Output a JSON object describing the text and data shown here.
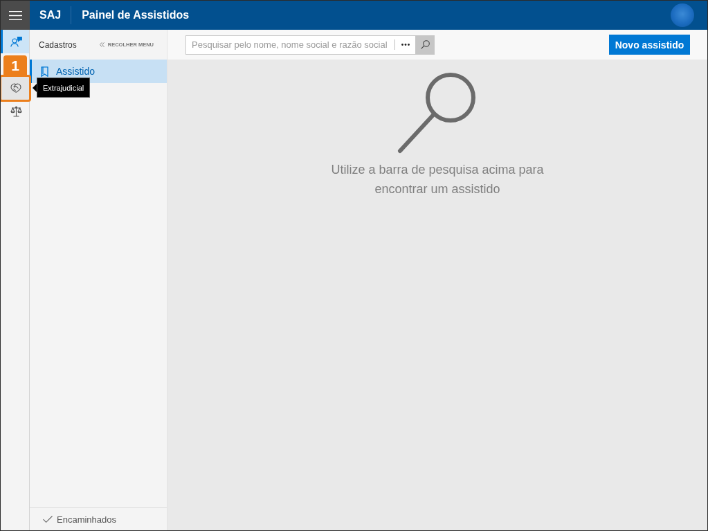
{
  "header": {
    "app_name": "SAJ",
    "title": "Painel de Assistidos"
  },
  "rail": {
    "items": [
      {
        "kind": "person",
        "selected": true,
        "hovered": false
      },
      {
        "kind": "handshake",
        "selected": false,
        "hovered": true,
        "tooltip": "Extrajudicial",
        "callout": "1"
      },
      {
        "kind": "scales",
        "selected": false,
        "hovered": false
      }
    ]
  },
  "side_panel": {
    "heading": "Cadastros",
    "collapse_label": "RECOLHER MENU",
    "items": [
      {
        "label": "Assistido",
        "selected": true
      }
    ],
    "footer": {
      "label": "Encaminhados"
    }
  },
  "toolbar": {
    "search": {
      "placeholder": "Pesquisar pelo nome, nome social e razão social"
    },
    "primary_button": "Novo assistido"
  },
  "empty_state": {
    "message": "Utilize a barra de pesquisa acima para encontrar um assistido"
  }
}
